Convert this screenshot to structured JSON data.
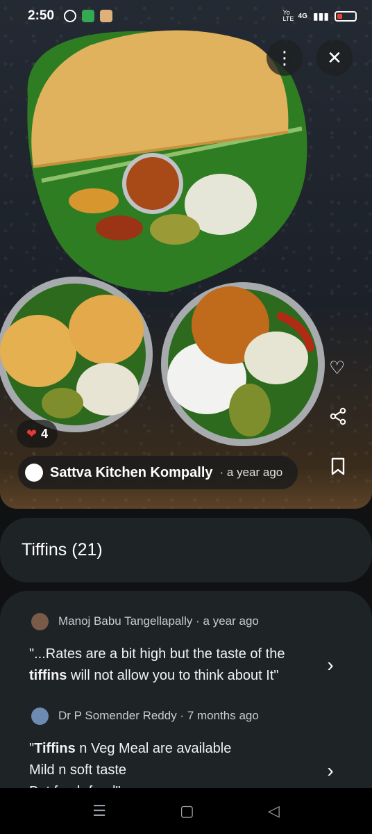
{
  "status_bar": {
    "time": "2:50",
    "network": "4G",
    "volte": "Yo LTE",
    "icons": [
      "whatsapp-icon",
      "green-app-icon",
      "box-app-icon"
    ],
    "battery_color": "#ea4335"
  },
  "photo": {
    "likes_count": "4",
    "author": "Sattva Kitchen Kompally",
    "time_ago": "· a year ago",
    "icons": [
      "more-vert-icon",
      "close-icon",
      "heart-icon",
      "share-icon",
      "bookmark-icon"
    ]
  },
  "tiffins": {
    "title": "Tiffins (21)"
  },
  "reviews": [
    {
      "meta": "Manoj Babu Tangellapally · a year ago",
      "quote_pre": "\"...Rates are a bit high but the taste of the ",
      "quote_bold": "tiffins",
      "quote_post": "  will not allow you to think about It\""
    },
    {
      "meta": "Dr P Somender Reddy · 7 months ago",
      "quote_pre": "\"",
      "quote_bold": "Tiffins",
      "quote_post": " n Veg Meal are available\nMild n soft taste\nBut fresh food\""
    }
  ],
  "nav": {
    "icons": [
      "recents-icon",
      "home-icon",
      "back-icon"
    ]
  }
}
